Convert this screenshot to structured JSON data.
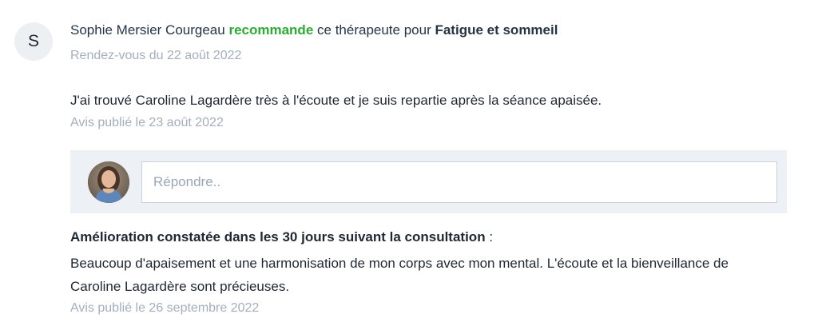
{
  "review": {
    "avatar_letter": "S",
    "author": "Sophie Mersier Courgeau",
    "verb": "recommande",
    "middle": "ce thérapeute pour",
    "topic": "Fatigue et sommeil",
    "appointment_date": "Rendez-vous du 22 août 2022",
    "comment": "J'ai trouvé Caroline Lagardère très à l'écoute et je suis repartie après la séance apaisée.",
    "published_date": "Avis publié le 23 août 2022"
  },
  "reply": {
    "placeholder": "Répondre.."
  },
  "improvement": {
    "title": "Amélioration constatée dans les 30 jours suivant la consultation",
    "separator": " :",
    "text": "Beaucoup d'apaisement et une harmonisation de mon corps avec mon mental. L'écoute et la bienveillance de Caroline Lagardère sont précieuses.",
    "published_date": "Avis publié le 26 septembre 2022"
  },
  "colors": {
    "recommend": "#2cab33",
    "muted": "#a3afbd",
    "reply_bg": "#edf1f5"
  }
}
